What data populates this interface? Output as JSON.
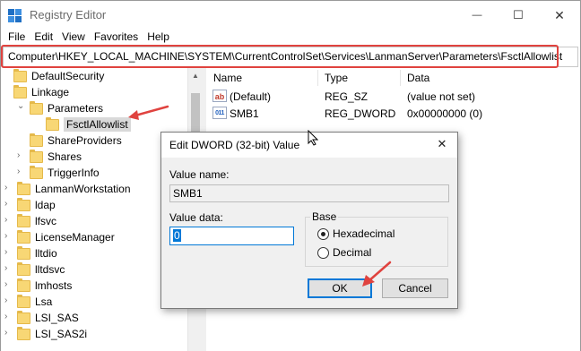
{
  "window": {
    "title": "Registry Editor",
    "minimize_glyph": "—",
    "maximize_glyph": "☐",
    "close_glyph": "✕"
  },
  "menu": [
    "File",
    "Edit",
    "View",
    "Favorites",
    "Help"
  ],
  "address": {
    "path": "Computer\\HKEY_LOCAL_MACHINE\\SYSTEM\\CurrentControlSet\\Services\\LanmanServer\\Parameters\\FsctlAllowlist"
  },
  "tree": {
    "items": [
      {
        "label": "DefaultSecurity",
        "level": 2,
        "expandable": false
      },
      {
        "label": "Linkage",
        "level": 2,
        "expandable": false
      },
      {
        "label": "Parameters",
        "level": 2,
        "expandable": true,
        "expanded": true
      },
      {
        "label": "FsctlAllowlist",
        "level": 3,
        "expandable": false,
        "selected": true
      },
      {
        "label": "ShareProviders",
        "level": 2,
        "expandable": false
      },
      {
        "label": "Shares",
        "level": 2,
        "expandable": true,
        "expanded": false
      },
      {
        "label": "TriggerInfo",
        "level": 2,
        "expandable": true,
        "expanded": false
      },
      {
        "label": "LanmanWorkstation",
        "level": 1,
        "expandable": true,
        "expanded": false
      },
      {
        "label": "ldap",
        "level": 1,
        "expandable": true,
        "expanded": false
      },
      {
        "label": "lfsvc",
        "level": 1,
        "expandable": true,
        "expanded": false
      },
      {
        "label": "LicenseManager",
        "level": 1,
        "expandable": true,
        "expanded": false
      },
      {
        "label": "lltdio",
        "level": 1,
        "expandable": true,
        "expanded": false
      },
      {
        "label": "lltdsvc",
        "level": 1,
        "expandable": true,
        "expanded": false
      },
      {
        "label": "lmhosts",
        "level": 1,
        "expandable": true,
        "expanded": false
      },
      {
        "label": "Lsa",
        "level": 1,
        "expandable": true,
        "expanded": false
      },
      {
        "label": "LSI_SAS",
        "level": 1,
        "expandable": true,
        "expanded": false
      },
      {
        "label": "LSI_SAS2i",
        "level": 1,
        "expandable": true,
        "expanded": false
      }
    ]
  },
  "list": {
    "columns": [
      "Name",
      "Type",
      "Data"
    ],
    "rows": [
      {
        "icon": "string-value-icon",
        "icon_glyph": "ab",
        "name": "(Default)",
        "type": "REG_SZ",
        "data": "(value not set)"
      },
      {
        "icon": "binary-value-icon",
        "icon_glyph": "011",
        "name": "SMB1",
        "type": "REG_DWORD",
        "data": "0x00000000 (0)"
      }
    ]
  },
  "dialog": {
    "title": "Edit DWORD (32-bit) Value",
    "value_name_label": "Value name:",
    "value_name": "SMB1",
    "value_data_label": "Value data:",
    "value_data": "0",
    "base_label": "Base",
    "radio_hex": "Hexadecimal",
    "radio_dec": "Decimal",
    "selected_base": "Hexadecimal",
    "ok_label": "OK",
    "cancel_label": "Cancel"
  },
  "colors": {
    "highlight": "#e0433f",
    "accent": "#0078d7",
    "folder": "#f8d775"
  }
}
